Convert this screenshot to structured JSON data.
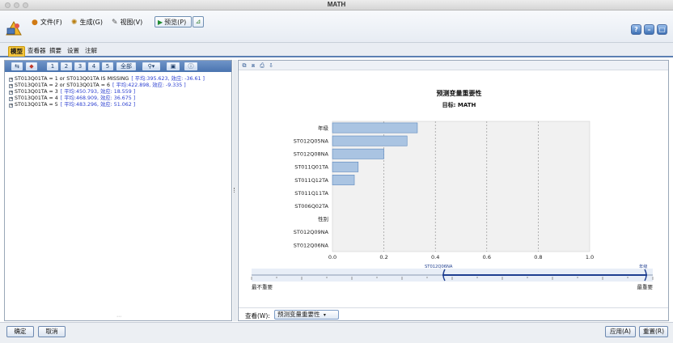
{
  "window": {
    "title": "MATH"
  },
  "menu": {
    "file": "文件(F)",
    "generate": "生成(G)",
    "view": "视图(V)",
    "preview": "预览(P)"
  },
  "tabs": [
    {
      "label": "模型",
      "active": true
    },
    {
      "label": "查看器",
      "active": false
    },
    {
      "label": "摘要",
      "active": false
    },
    {
      "label": "设置",
      "active": false
    },
    {
      "label": "注解",
      "active": false
    }
  ],
  "left_toolbar": {
    "levels": [
      "1",
      "2",
      "3",
      "4",
      "5"
    ],
    "all_label": "全部"
  },
  "rules": [
    {
      "text": "ST013Q01TA = 1 or ST013Q01TA IS MISSING",
      "stat": "[ 平均:395.623, 效应: -36.61 ]"
    },
    {
      "text": "ST013Q01TA = 2 or ST013Q01TA = 6",
      "stat": "[ 平均:422.898, 效应: -9.335 ]"
    },
    {
      "text": "ST013Q01TA = 3",
      "stat": "[ 平均:450.793, 效应: 18.559 ]"
    },
    {
      "text": "ST013Q01TA = 4",
      "stat": "[ 平均:468.909, 效应: 36.675 ]"
    },
    {
      "text": "ST013Q01TA = 5",
      "stat": "[ 平均:483.296, 效应: 51.062 ]"
    }
  ],
  "chart_data": {
    "type": "bar",
    "orientation": "horizontal",
    "title": "预测变量重要性",
    "subtitle": "目标: MATH",
    "categories": [
      "年级",
      "ST012Q05NA",
      "ST012Q08NA",
      "ST011Q01TA",
      "ST011Q12TA",
      "ST011Q11TA",
      "ST006Q02TA",
      "性别",
      "ST012Q09NA",
      "ST012Q06NA"
    ],
    "values": [
      0.33,
      0.29,
      0.2,
      0.1,
      0.085,
      0,
      0,
      0,
      0,
      0
    ],
    "xlim": [
      0.0,
      1.0
    ],
    "xticks": [
      "0.0",
      "0.2",
      "0.4",
      "0.6",
      "0.8",
      "1.0"
    ],
    "grid": true,
    "bar_color": "#aac4e2"
  },
  "slider": {
    "left_marker": "ST012Q06NA",
    "right_marker": "年级",
    "least_label": "最不重要",
    "most_label": "最重要"
  },
  "view": {
    "label": "查看(W):",
    "selected": "预测变量重要性"
  },
  "footer": {
    "ok": "确定",
    "cancel": "取消",
    "apply": "应用(A)",
    "reset": "重置(R)"
  }
}
